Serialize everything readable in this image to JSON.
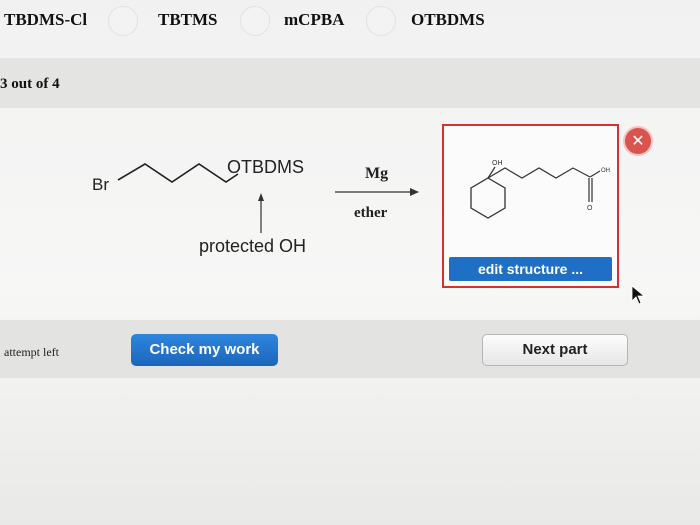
{
  "tabs": [
    {
      "label": "TBDMS-Cl"
    },
    {
      "label": "TBTMS"
    },
    {
      "label": "mCPBA"
    },
    {
      "label": "OTBDMS"
    }
  ],
  "progress": {
    "text": "3 out of 4"
  },
  "reaction": {
    "reactant_br": "Br",
    "reactant_group": "OTBDMS",
    "annotation": "protected OH",
    "reagent": "Mg",
    "solvent": "ether"
  },
  "answer": {
    "oh_left": "OH",
    "oh_right": "OH",
    "carbonyl_o": "O",
    "edit_label": "edit structure ...",
    "close_icon": "close-icon"
  },
  "footer": {
    "attempts": "attempt left",
    "check_label": "Check my work",
    "next_label": "Next part"
  },
  "colors": {
    "accent": "#1f6fc4",
    "error": "#d63030",
    "close": "#d9534f"
  }
}
